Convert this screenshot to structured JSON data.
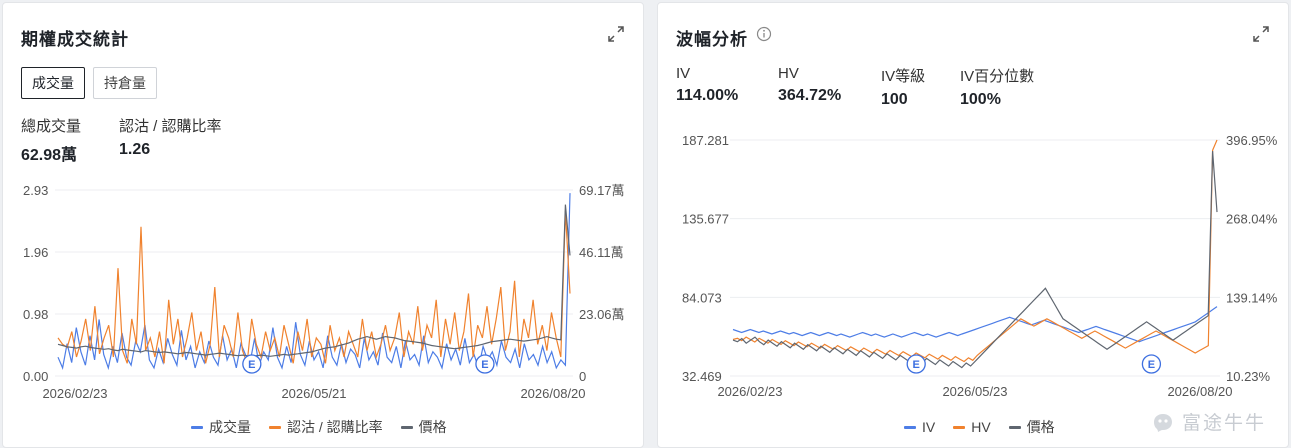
{
  "left": {
    "title": "期權成交統計",
    "tabs": [
      "成交量",
      "持倉量"
    ],
    "stats": [
      {
        "label": "總成交量",
        "value": "62.98萬"
      },
      {
        "label": "認沽 / 認購比率",
        "value": "1.26"
      }
    ]
  },
  "right": {
    "title": "波幅分析",
    "stats": [
      {
        "label": "IV",
        "value": "114.00%"
      },
      {
        "label": "HV",
        "value": "364.72%"
      },
      {
        "label": "IV等級",
        "value": "100"
      },
      {
        "label": "IV百分位數",
        "value": "100%"
      }
    ]
  },
  "colors": {
    "blue": "#4d7de6",
    "orange": "#f0822e",
    "gray": "#5f6670",
    "grid": "#eceef1",
    "accent": "#3d6fe0"
  },
  "icons": {
    "expand": "expand-arrows-icon",
    "info": "info-circle-icon",
    "earnings": "earnings-e-marker-icon",
    "logo": "futu-logo-icon"
  },
  "watermark": "富途牛牛",
  "chart_data": [
    {
      "type": "line",
      "x_ticks": [
        "2026/02/23",
        "2026/05/21",
        "2026/08/20"
      ],
      "y_left_ticks": [
        "0.00",
        "0.98",
        "1.96",
        "2.93"
      ],
      "y_left_range": [
        0,
        2.93
      ],
      "y_right_ticks": [
        "0",
        "23.06萬",
        "46.11萬",
        "69.17萬"
      ],
      "y_right_range": [
        0,
        69.17
      ],
      "earnings_markers": [
        {
          "label": "E",
          "position": 0.38
        },
        {
          "label": "E",
          "position": 0.83
        }
      ],
      "grid": true,
      "legend_position": "bottom-center",
      "series": [
        {
          "name": "成交量",
          "color": "#4d7de6",
          "axis": "right",
          "values": [
            7,
            3,
            12,
            5,
            18,
            9,
            4,
            15,
            6,
            21,
            8,
            3,
            11,
            5,
            16,
            7,
            4,
            13,
            9,
            19,
            6,
            3,
            10,
            5,
            14,
            8,
            4,
            17,
            6,
            11,
            3,
            9,
            5,
            13,
            7,
            4,
            15,
            6,
            10,
            3,
            12,
            8,
            5,
            14,
            4,
            9,
            6,
            18,
            7,
            3,
            11,
            5,
            20,
            8,
            4,
            13,
            6,
            9,
            3,
            15,
            7,
            4,
            12,
            5,
            10,
            8,
            3,
            14,
            6,
            9,
            4,
            16,
            7,
            5,
            11,
            3,
            13,
            6,
            8,
            4,
            15,
            5,
            9,
            7,
            3,
            12,
            6,
            10,
            4,
            14,
            5,
            8,
            3,
            11,
            6,
            9,
            4,
            13,
            7,
            5,
            10,
            3,
            12,
            6,
            8,
            4,
            11,
            5,
            9,
            3,
            6,
            4,
            68
          ]
        },
        {
          "name": "認沽 / 認購比率",
          "color": "#f0822e",
          "axis": "left",
          "values": [
            0.6,
            0.5,
            0.45,
            0.7,
            0.3,
            0.55,
            0.9,
            0.4,
            1.1,
            0.35,
            0.6,
            0.8,
            0.3,
            1.7,
            0.4,
            0.2,
            0.9,
            0.5,
            2.35,
            0.4,
            0.6,
            0.3,
            0.7,
            0.2,
            1.2,
            0.5,
            0.9,
            0.3,
            0.6,
            1.0,
            0.4,
            0.7,
            0.2,
            0.5,
            1.4,
            0.3,
            0.8,
            0.6,
            0.3,
            1.0,
            0.4,
            0.2,
            0.9,
            0.5,
            0.3,
            0.7,
            0.4,
            0.6,
            0.3,
            0.8,
            0.5,
            0.2,
            0.7,
            0.4,
            0.9,
            0.3,
            0.6,
            0.5,
            0.2,
            0.8,
            0.4,
            0.6,
            0.3,
            0.7,
            0.5,
            0.3,
            0.9,
            0.4,
            0.7,
            0.3,
            0.5,
            0.8,
            0.4,
            0.6,
            1.0,
            0.3,
            0.7,
            0.5,
            1.1,
            0.4,
            0.8,
            0.6,
            1.2,
            0.3,
            0.9,
            0.5,
            1.0,
            0.4,
            0.7,
            1.3,
            0.3,
            0.8,
            0.6,
            1.1,
            0.5,
            0.9,
            1.4,
            0.4,
            0.7,
            1.5,
            0.3,
            0.9,
            0.6,
            1.2,
            0.5,
            0.8,
            0.4,
            1.0,
            0.6,
            0.3,
            2.6,
            1.3
          ]
        },
        {
          "name": "價格",
          "color": "#5f6670",
          "axis": "left",
          "values": [
            0.5,
            0.48,
            0.46,
            0.45,
            0.44,
            0.46,
            0.47,
            0.45,
            0.44,
            0.43,
            0.42,
            0.43,
            0.41,
            0.4,
            0.42,
            0.41,
            0.4,
            0.39,
            0.38,
            0.4,
            0.39,
            0.38,
            0.37,
            0.38,
            0.37,
            0.36,
            0.35,
            0.36,
            0.37,
            0.36,
            0.35,
            0.34,
            0.33,
            0.34,
            0.35,
            0.36,
            0.35,
            0.34,
            0.33,
            0.32,
            0.33,
            0.32,
            0.31,
            0.32,
            0.33,
            0.32,
            0.31,
            0.32,
            0.33,
            0.34,
            0.33,
            0.34,
            0.35,
            0.36,
            0.37,
            0.38,
            0.4,
            0.42,
            0.44,
            0.45,
            0.46,
            0.48,
            0.5,
            0.52,
            0.55,
            0.58,
            0.6,
            0.62,
            0.6,
            0.58,
            0.6,
            0.62,
            0.61,
            0.6,
            0.58,
            0.56,
            0.55,
            0.54,
            0.53,
            0.52,
            0.5,
            0.48,
            0.47,
            0.46,
            0.45,
            0.44,
            0.43,
            0.44,
            0.45,
            0.46,
            0.47,
            0.48,
            0.5,
            0.52,
            0.54,
            0.55,
            0.56,
            0.57,
            0.58,
            0.57,
            0.56,
            0.55,
            0.56,
            0.57,
            0.58,
            0.6,
            0.62,
            0.6,
            0.58,
            0.57,
            2.7,
            1.9
          ]
        }
      ]
    },
    {
      "type": "line",
      "x_ticks": [
        "2026/02/23",
        "2026/05/23",
        "2026/08/20"
      ],
      "y_left_ticks": [
        "32.469",
        "84.073",
        "135.677",
        "187.281"
      ],
      "y_left_range": [
        32.469,
        187.281
      ],
      "y_right_ticks": [
        "10.23%",
        "139.14%",
        "268.04%",
        "396.95%"
      ],
      "y_right_range": [
        10.23,
        396.95
      ],
      "earnings_markers": [
        {
          "label": "E",
          "position": 0.38
        },
        {
          "label": "E",
          "position": 0.86
        }
      ],
      "grid": true,
      "legend_position": "bottom-center",
      "series": [
        {
          "name": "IV",
          "color": "#4d7de6",
          "axis": "left",
          "values": [
            63,
            62,
            61,
            62,
            63,
            62,
            61,
            62,
            61,
            60,
            61,
            62,
            61,
            60,
            61,
            60,
            59,
            60,
            61,
            60,
            59,
            60,
            61,
            60,
            59,
            60,
            59,
            58,
            59,
            60,
            61,
            60,
            59,
            60,
            59,
            58,
            59,
            60,
            59,
            58,
            59,
            60,
            61,
            60,
            59,
            60,
            59,
            58,
            59,
            60,
            61,
            60,
            59,
            60,
            61,
            62,
            63,
            64,
            65,
            66,
            67,
            68,
            69,
            70,
            71,
            70,
            69,
            68,
            67,
            66,
            67,
            68,
            69,
            68,
            67,
            66,
            65,
            64,
            63,
            62,
            61,
            62,
            63,
            64,
            65,
            64,
            63,
            62,
            61,
            60,
            59,
            58,
            57,
            56,
            55,
            56,
            57,
            58,
            59,
            60,
            61,
            62,
            63,
            64,
            65,
            66,
            67,
            68,
            70,
            72,
            74,
            76,
            78
          ]
        },
        {
          "name": "HV",
          "color": "#f0822e",
          "axis": "right",
          "values": [
            70,
            72,
            68,
            74,
            70,
            66,
            72,
            68,
            64,
            70,
            66,
            62,
            68,
            64,
            60,
            66,
            62,
            58,
            64,
            60,
            56,
            62,
            58,
            54,
            60,
            56,
            52,
            58,
            54,
            50,
            56,
            52,
            48,
            54,
            50,
            46,
            52,
            48,
            44,
            50,
            46,
            42,
            48,
            44,
            40,
            46,
            42,
            38,
            44,
            40,
            36,
            42,
            38,
            34,
            40,
            36,
            44,
            50,
            56,
            62,
            68,
            74,
            80,
            86,
            92,
            98,
            104,
            100,
            96,
            92,
            96,
            100,
            104,
            100,
            96,
            92,
            88,
            84,
            80,
            76,
            72,
            76,
            80,
            84,
            80,
            76,
            72,
            68,
            64,
            60,
            56,
            60,
            64,
            68,
            72,
            76,
            80,
            84,
            80,
            76,
            72,
            68,
            64,
            60,
            56,
            52,
            48,
            52,
            56,
            60,
            380,
            397
          ]
        },
        {
          "name": "價格",
          "color": "#5f6670",
          "axis": "left",
          "values": [
            56,
            55,
            57,
            54,
            56,
            58,
            55,
            53,
            56,
            54,
            52,
            55,
            53,
            51,
            54,
            52,
            50,
            53,
            51,
            49,
            52,
            50,
            48,
            51,
            49,
            47,
            50,
            48,
            46,
            49,
            47,
            45,
            48,
            46,
            44,
            47,
            45,
            43,
            46,
            44,
            42,
            45,
            43,
            41,
            44,
            42,
            40,
            43,
            41,
            39,
            42,
            40,
            38,
            41,
            39,
            42,
            45,
            48,
            51,
            54,
            57,
            60,
            63,
            66,
            69,
            72,
            75,
            78,
            81,
            84,
            87,
            90,
            85,
            80,
            75,
            70,
            68,
            66,
            64,
            62,
            60,
            58,
            56,
            54,
            52,
            50,
            52,
            54,
            56,
            58,
            60,
            62,
            64,
            66,
            68,
            66,
            64,
            62,
            60,
            58,
            56,
            58,
            60,
            62,
            64,
            66,
            68,
            70,
            72,
            180,
            140
          ]
        }
      ]
    }
  ]
}
